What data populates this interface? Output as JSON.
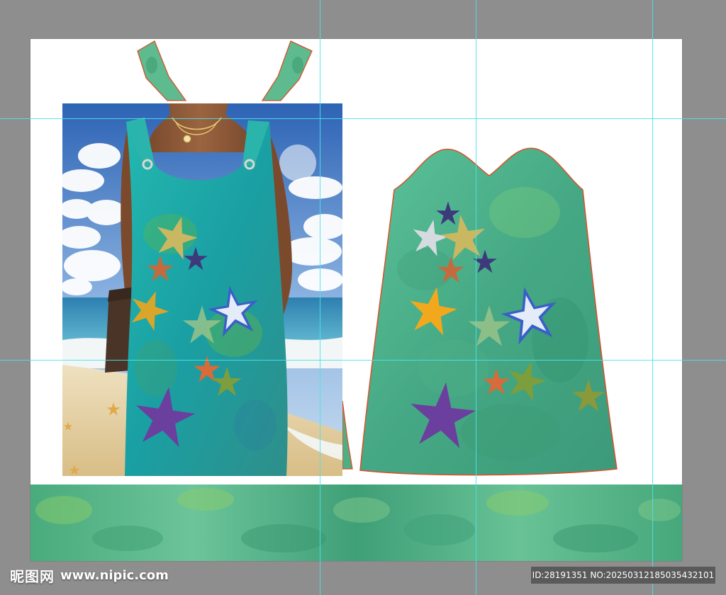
{
  "watermark": {
    "site_name": "昵图网",
    "url": "www.nipic.com"
  },
  "image_id": {
    "text": "ID:28191351 NO:20250312185035432101"
  },
  "colors": {
    "workspace": "#8e8e8e",
    "artboard": "#ffffff",
    "guide": "#49e3ea",
    "pattern_outline": "#d9502a",
    "dress_teal": "#1fb3a6",
    "dress_green": "#4caf78",
    "sky_blue": "#4f86c6",
    "sand": "#e6cf9e",
    "star_purple": "#6b3f9e",
    "star_yellow": "#f2a81d",
    "star_blue": "#3a5fc8",
    "star_orange": "#d96a3a",
    "star_olive": "#8a9a3a"
  },
  "icons": [
    "starfish-icon"
  ]
}
